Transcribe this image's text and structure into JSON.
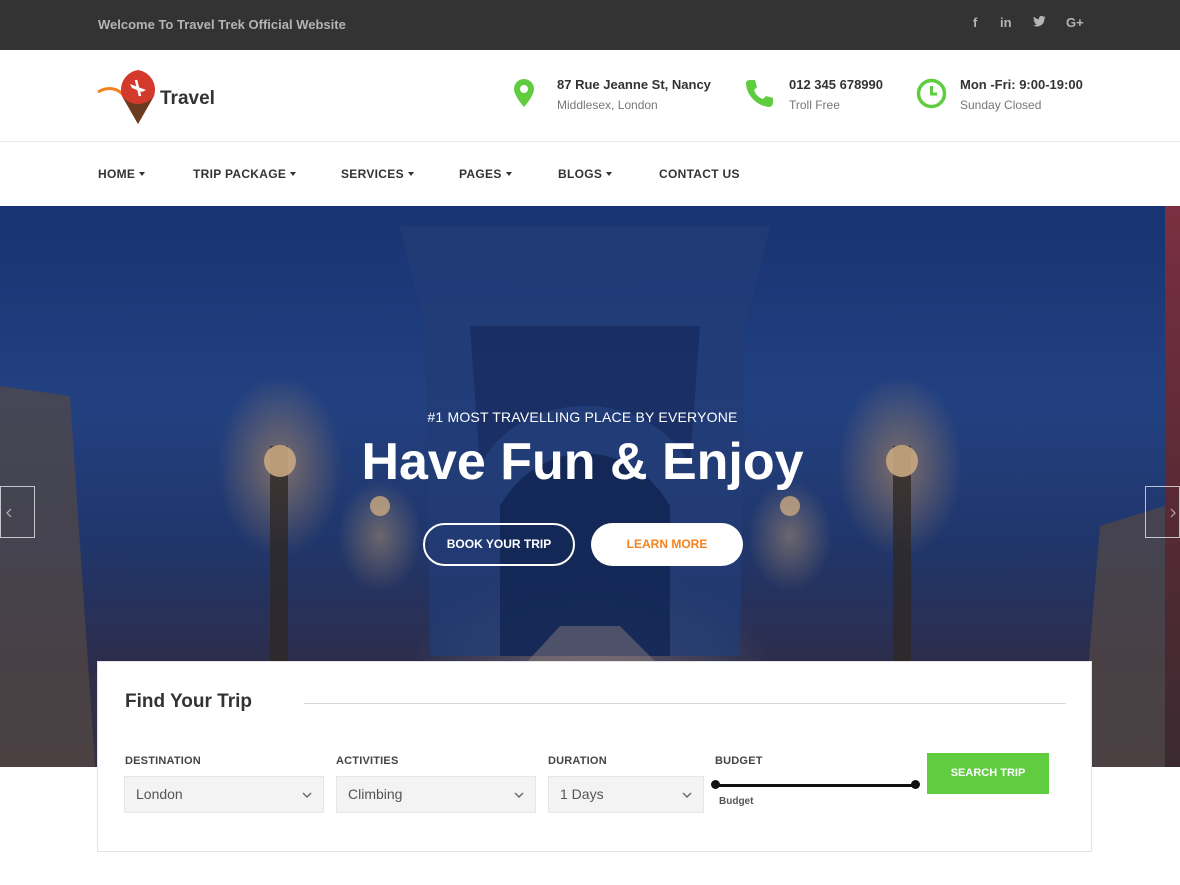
{
  "topbar": {
    "welcome": "Welcome To Travel Trek Official Website",
    "social": [
      {
        "icon": "facebook-icon",
        "glyph": "f"
      },
      {
        "icon": "linkedin-icon",
        "glyph": "in"
      },
      {
        "icon": "twitter-icon",
        "glyph": "y"
      },
      {
        "icon": "google-plus-icon",
        "glyph": "G+"
      }
    ]
  },
  "header": {
    "logo_text": "Travel",
    "address": {
      "line1": "87 Rue Jeanne St, Nancy",
      "line2": "Middlesex, London",
      "icon": "location-pin-icon"
    },
    "phone": {
      "line1": "012 345 678990",
      "line2": "Troll Free",
      "icon": "phone-icon"
    },
    "hours": {
      "line1": "Mon -Fri: 9:00-19:00",
      "line2": "Sunday Closed",
      "icon": "clock-icon"
    }
  },
  "nav": {
    "items": [
      {
        "label": "HOME",
        "dropdown": true
      },
      {
        "label": "TRIP PACKAGE",
        "dropdown": true
      },
      {
        "label": "SERVICES",
        "dropdown": true
      },
      {
        "label": "PAGES",
        "dropdown": true
      },
      {
        "label": "BLOGS",
        "dropdown": true
      },
      {
        "label": "CONTACT US",
        "dropdown": false
      }
    ]
  },
  "hero": {
    "subtitle": "#1 MOST TRAVELLING PLACE BY EVERYONE",
    "title": "Have Fun & Enjoy",
    "book_label": "BOOK YOUR TRIP",
    "learn_label": "LEARN MORE"
  },
  "trip": {
    "title": "Find Your Trip",
    "destination": {
      "label": "DESTINATION",
      "value": "London"
    },
    "activities": {
      "label": "ACTIVITIES",
      "value": "Climbing"
    },
    "duration": {
      "label": "DURATION",
      "value": "1 Days"
    },
    "budget": {
      "label": "BUDGET",
      "caption": "Budget"
    },
    "search_label": "SEARCH TRIP"
  },
  "colors": {
    "accent_green": "#5fcd3f",
    "accent_orange": "#f58220",
    "topbar_bg": "#333333"
  }
}
